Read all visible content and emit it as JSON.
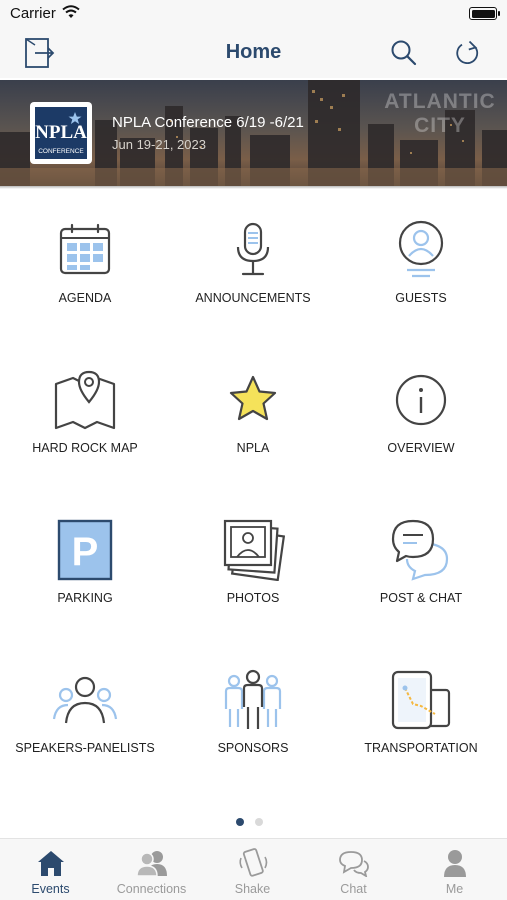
{
  "status_bar": {
    "carrier": "Carrier"
  },
  "nav": {
    "title": "Home"
  },
  "banner": {
    "logo_top": "NPLA",
    "logo_bottom": "CONFERENCE",
    "event_name": "NPLA Conference 6/19 -6/21",
    "event_dates": "Jun 19-21, 2023",
    "watermark_line1": "ATLANTIC",
    "watermark_line2": "CITY"
  },
  "grid": {
    "items": [
      {
        "label": "AGENDA",
        "icon": "calendar-icon"
      },
      {
        "label": "ANNOUNCEMENTS",
        "icon": "microphone-icon"
      },
      {
        "label": "GUESTS",
        "icon": "guest-profile-icon"
      },
      {
        "label": "HARD ROCK MAP",
        "icon": "map-pin-icon"
      },
      {
        "label": "NPLA",
        "icon": "star-icon"
      },
      {
        "label": "OVERVIEW",
        "icon": "info-icon"
      },
      {
        "label": "PARKING",
        "icon": "parking-icon"
      },
      {
        "label": "PHOTOS",
        "icon": "photos-icon"
      },
      {
        "label": "POST & CHAT",
        "icon": "chat-bubbles-icon"
      },
      {
        "label": "SPEAKERS-PANELISTS",
        "icon": "people-group-icon"
      },
      {
        "label": "SPONSORS",
        "icon": "sponsors-icon"
      },
      {
        "label": "TRANSPORTATION",
        "icon": "transportation-map-icon"
      }
    ]
  },
  "pager": {
    "pages": 2,
    "current": 1
  },
  "tabs": [
    {
      "label": "Events",
      "icon": "house-icon",
      "active": true
    },
    {
      "label": "Connections",
      "icon": "connections-icon",
      "active": false
    },
    {
      "label": "Shake",
      "icon": "shake-phone-icon",
      "active": false
    },
    {
      "label": "Chat",
      "icon": "chat-icon",
      "active": false
    },
    {
      "label": "Me",
      "icon": "person-icon",
      "active": false
    }
  ],
  "colors": {
    "accent": "#2c4a6e",
    "icon_blue": "#9cc3ec",
    "star_yellow": "#f5e25a",
    "inactive_tab": "#9a9a9a"
  }
}
